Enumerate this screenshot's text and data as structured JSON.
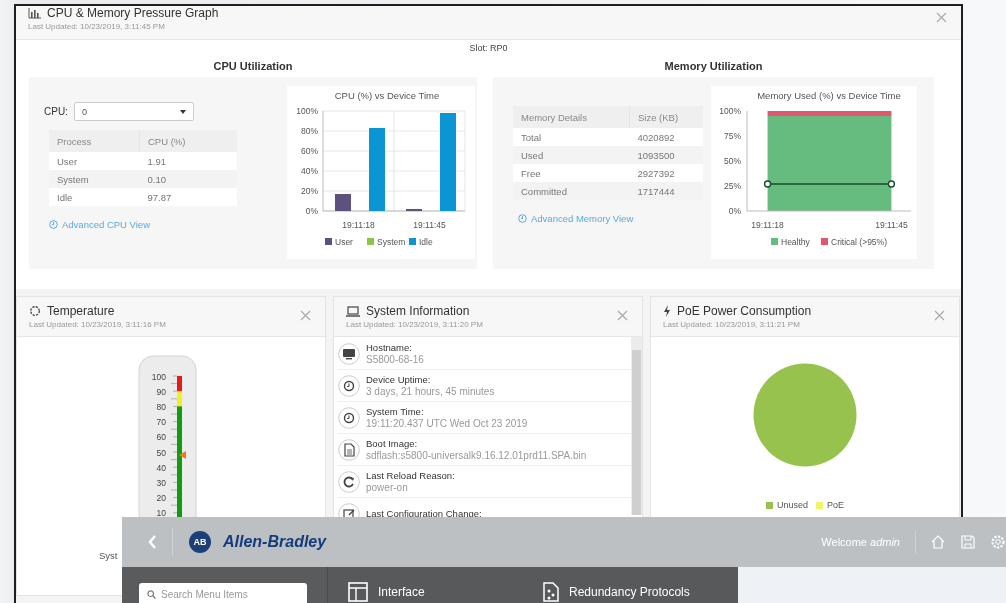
{
  "cpu_memory_panel": {
    "title": "CPU & Memory Pressure Graph",
    "updated": "Last Updated: 10/23/2019, 3:11:45 PM",
    "slot": "Slot: RP0",
    "cpu": {
      "heading": "CPU Utilization",
      "select_label": "CPU:",
      "select_value": "0",
      "table": {
        "columns": [
          "Process",
          "CPU (%)"
        ],
        "rows": [
          [
            "User",
            "1.91"
          ],
          [
            "System",
            "0.10"
          ],
          [
            "Idle",
            "97.87"
          ]
        ]
      },
      "link": "Advanced CPU View",
      "chart_data": {
        "type": "bar",
        "title": "CPU (%) vs Device Time",
        "categories": [
          "19:11:18",
          "19:11:45"
        ],
        "series": [
          {
            "name": "User",
            "color": "#5d5180",
            "values": [
              17,
              2
            ]
          },
          {
            "name": "System",
            "color": "#8dc63f",
            "values": [
              0,
              0
            ]
          },
          {
            "name": "Idle",
            "color": "#0b96d3",
            "values": [
              83,
              98
            ]
          }
        ],
        "grid": true,
        "legend": true,
        "ylim": [
          0,
          100
        ],
        "yticks": [
          {
            "value": 0,
            "label": "0%"
          },
          {
            "value": 20,
            "label": "20%"
          },
          {
            "value": 40,
            "label": "40%"
          },
          {
            "value": 60,
            "label": "60%"
          },
          {
            "value": 80,
            "label": "80%"
          },
          {
            "value": 100,
            "label": "100%"
          }
        ]
      }
    },
    "memory": {
      "heading": "Memory Utilization",
      "table": {
        "columns": [
          "Memory Details",
          "Size (KB)"
        ],
        "rows": [
          [
            "Total",
            "4020892"
          ],
          [
            "Used",
            "1093500"
          ],
          [
            "Free",
            "2927392"
          ],
          [
            "Committed",
            "1717444"
          ]
        ]
      },
      "link": "Advanced Memory View",
      "chart_data": {
        "type": "area",
        "title": "Memory Used (%) vs Device Time",
        "categories": [
          "19:11:18",
          "19:11:45"
        ],
        "stacked": true,
        "series": [
          {
            "name": "Healthy",
            "color": "#66bb7f",
            "values": [
              95,
              95
            ]
          },
          {
            "name": "Critical (>95%)",
            "color": "#e2566e",
            "values": [
              5,
              5
            ]
          },
          {
            "type": "line",
            "color": "#1d4a2a",
            "marker": true,
            "values": [
              27,
              27
            ]
          }
        ],
        "legend": true,
        "ylim": [
          0,
          100
        ],
        "yticks": [
          {
            "value": 0,
            "label": "0%"
          },
          {
            "value": 25,
            "label": "25%"
          },
          {
            "value": 50,
            "label": "50%"
          },
          {
            "value": 75,
            "label": "75%"
          },
          {
            "value": 100,
            "label": "100%"
          }
        ]
      }
    }
  },
  "temperature_panel": {
    "title": "Temperature",
    "updated": "Last Updated: 10/23/2019, 3:11:16 PM",
    "gauge": {
      "scale": [
        "100",
        "90",
        "80",
        "70",
        "60",
        "50",
        "40",
        "30",
        "20",
        "10"
      ],
      "level": 0.48
    },
    "caption": "Syst"
  },
  "system_info_panel": {
    "title": "System Information",
    "updated": "Last Updated: 10/23/2019, 3:11:20 PM",
    "items": [
      {
        "kind": "monitor",
        "label": "Hostname:",
        "value": "S5800-68-16"
      },
      {
        "kind": "clock",
        "label": "Device Uptime:",
        "value": "3 days, 21 hours, 45 minutes"
      },
      {
        "kind": "clock",
        "label": "System Time:",
        "value": "19:11:20.437 UTC Wed Oct 23 2019"
      },
      {
        "kind": "file",
        "label": "Boot Image:",
        "value": "sdflash:s5800-universalk9.16.12.01prd11.SPA.bin"
      },
      {
        "kind": "reload",
        "label": "Last Reload Reason:",
        "value": "power-on"
      },
      {
        "kind": "config",
        "label": "Last Configuration Change:"
      }
    ]
  },
  "poe_panel": {
    "title": "PoE Power Consumption",
    "updated": "Last Updated: 10/23/2019, 3:11:21 PM",
    "legend": [
      {
        "label": "Unused",
        "color": "#97c24e"
      },
      {
        "label": "PoE",
        "color": "#f3f36a"
      }
    ]
  },
  "app_window": {
    "logo_badge": "AB",
    "brand": "Allen-Bradley",
    "welcome": "Welcome *admin*",
    "search": {
      "placeholder": "Search Menu Items"
    },
    "menu_items": [
      {
        "kind": "interface",
        "label": "Interface"
      },
      {
        "kind": "redundancy",
        "label": "Redundancy Protocols"
      }
    ]
  }
}
